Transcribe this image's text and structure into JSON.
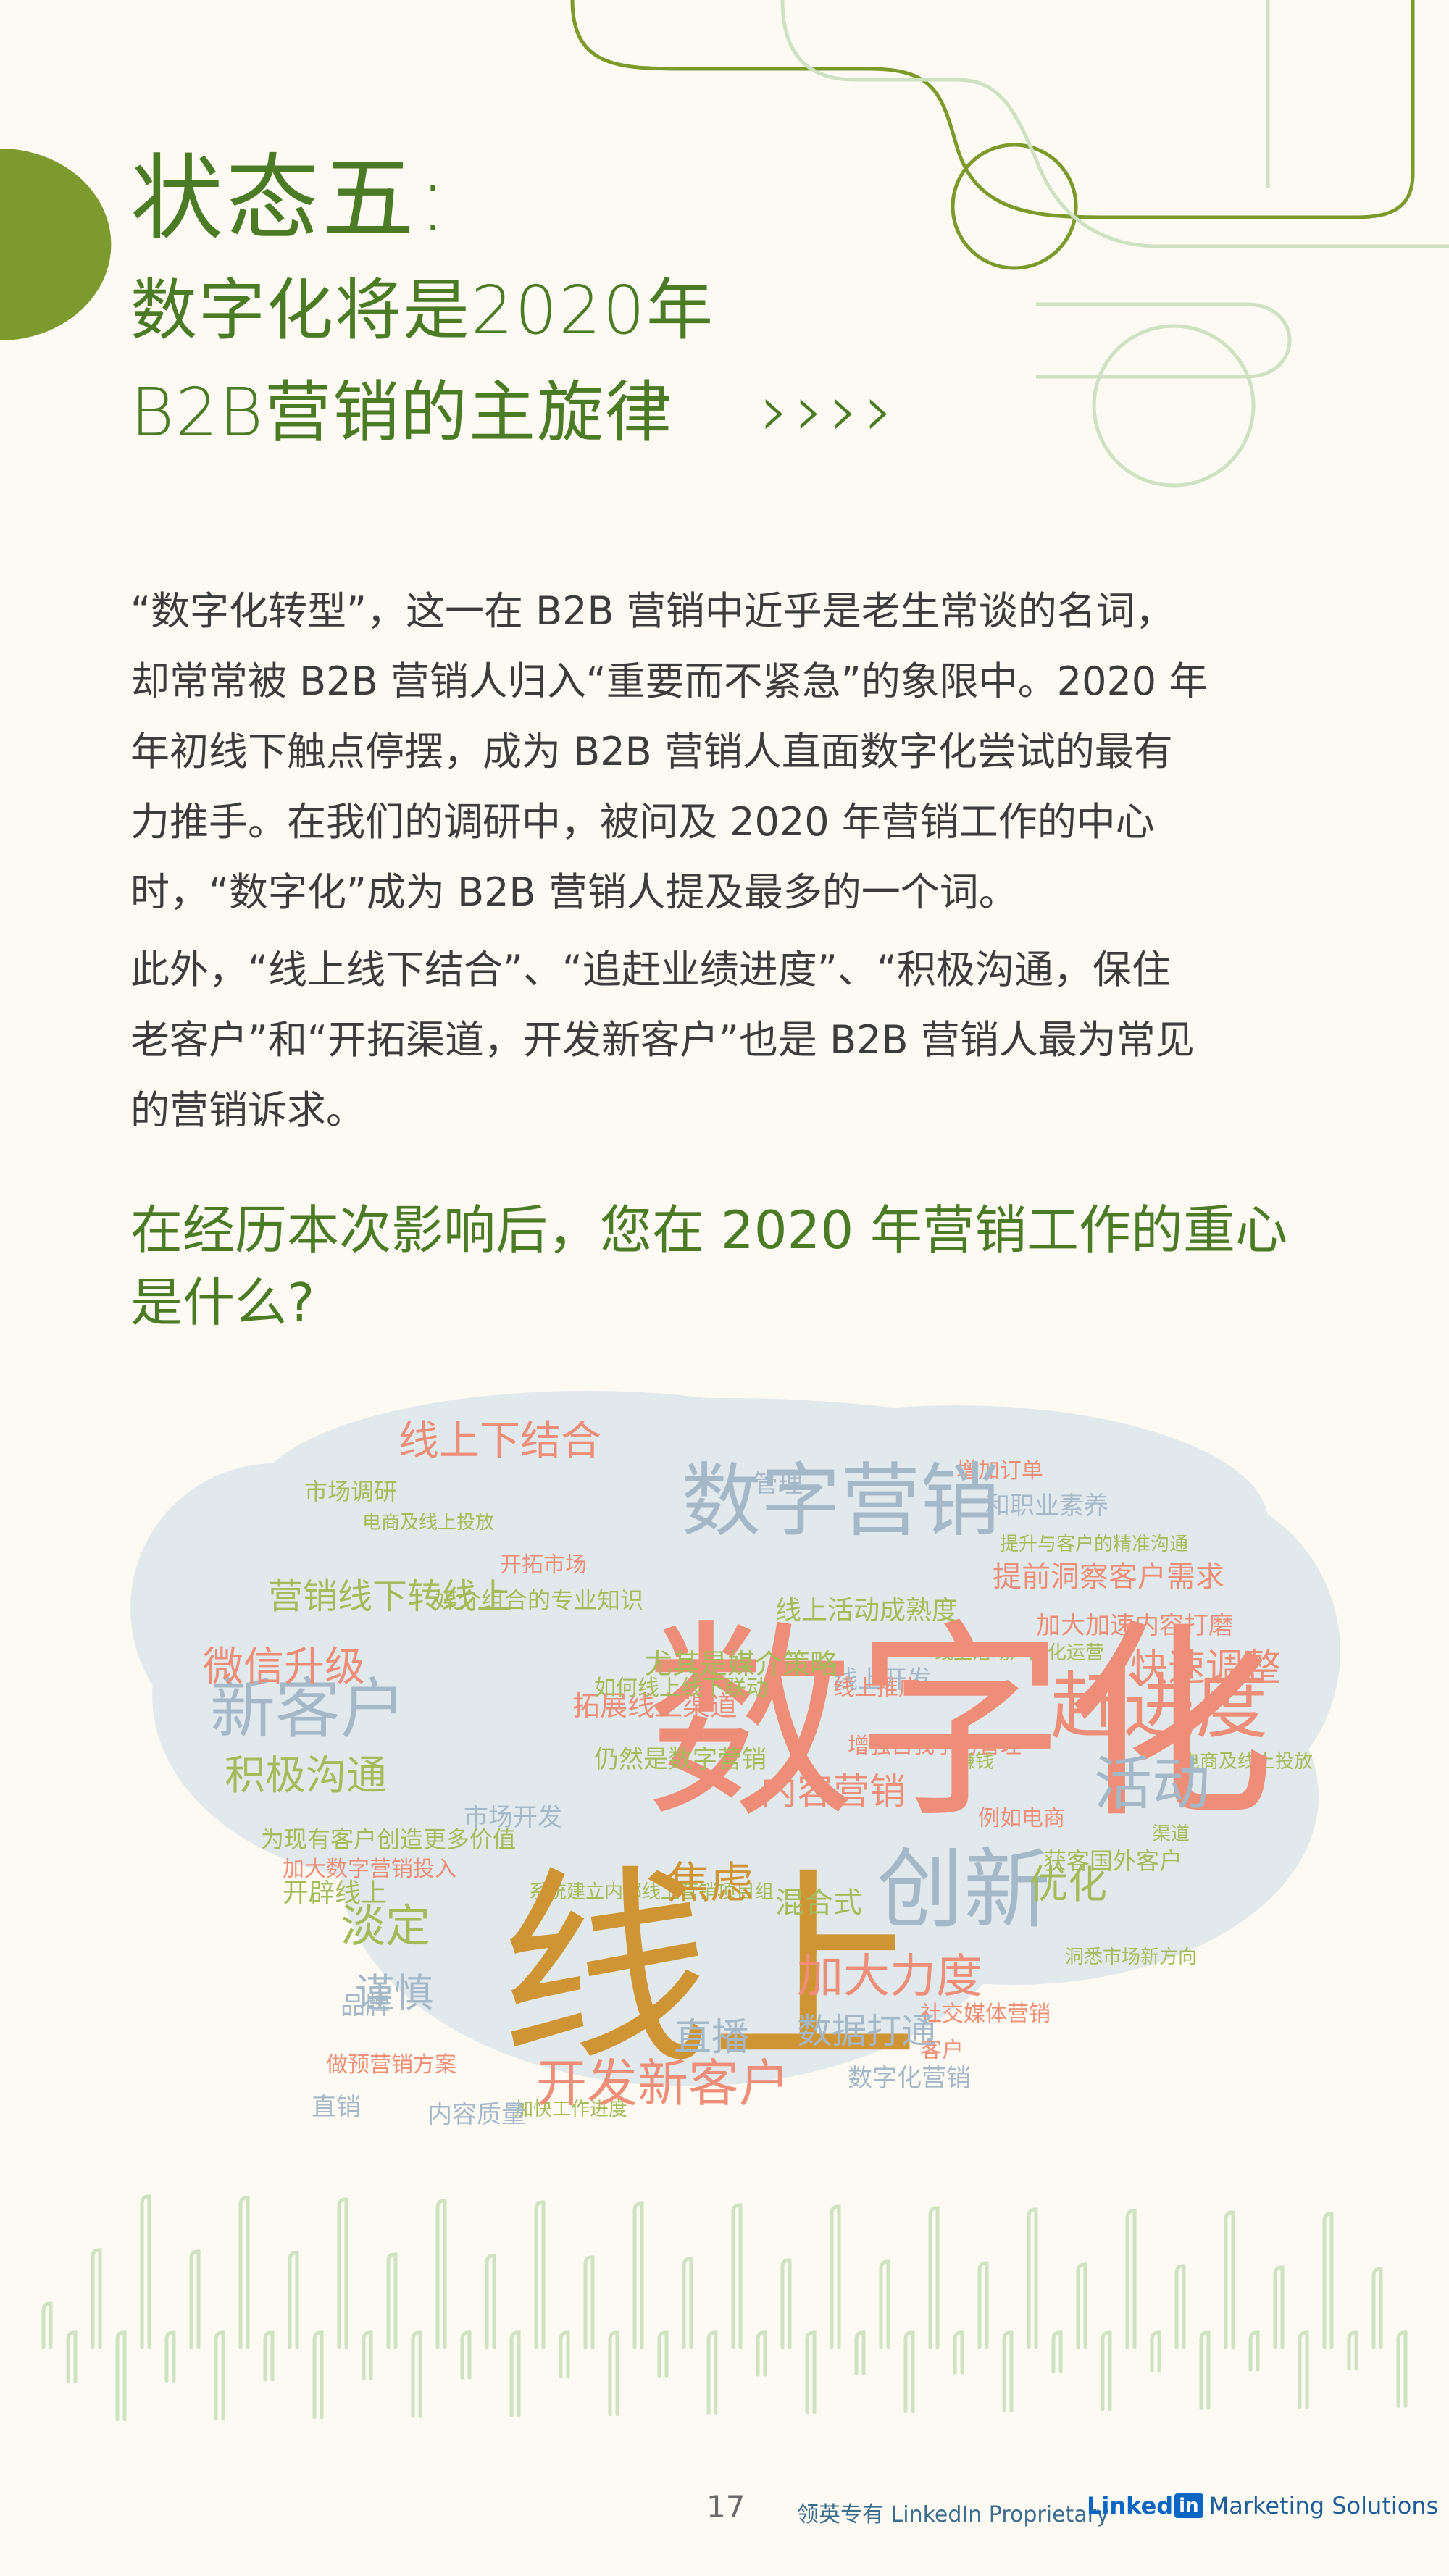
{
  "header": {
    "title": "状态五:",
    "subtitle_line1": "数字化将是2020年",
    "subtitle_line2": "B2B营销的主旋律",
    "arrows": "››››"
  },
  "body": {
    "p1": [
      "“数字化转型”，这一在 B2B 营销中近乎是老生常谈的名词，",
      "却常常被 B2B 营销人归入“重要而不紧急”的象限中。2020 年",
      "年初线下触点停摆，成为 B2B 营销人直面数字化尝试的最有",
      "力推手。在我们的调研中，被问及 2020 年营销工作的中心",
      "时，“数字化”成为 B2B 营销人提及最多的一个词。"
    ],
    "p2": [
      "此外，“线上线下结合”、“追赶业绩进度”、“积极沟通，保住",
      "老客户”和“开拓渠道，开发新客户”也是 B2B 营销人最为常见",
      "的营销诉求。"
    ]
  },
  "question": {
    "line1": "在经历本次影响后，您在 2020 年营销工作的重心",
    "line2": "是什么?"
  },
  "wordcloud": {
    "words": [
      "数字化",
      "线上",
      "数字营销",
      "创新",
      "赶进度",
      "新客户",
      "线上下结合",
      "营销线下转线上",
      "微信升级",
      "积极沟通",
      "活动",
      "快速调整",
      "开发新客户",
      "加大力度",
      "数据打通",
      "直播",
      "淡定",
      "谨慎",
      "焦虑",
      "混合式",
      "优化",
      "内容营销",
      "尤其是媒介策略",
      "仍然是数字营销",
      "线上活动成熟度",
      "提前洞察客户需求",
      "获客国外客户",
      "市场调研",
      "拓展线上渠道",
      "如何线上线下联动",
      "媒介组合的专业知识",
      "加大加速内容打磨",
      "开辟线上",
      "加大数字营销投入",
      "为现有客户创造更多价值",
      "电商及线上投放",
      "增加订单",
      "和职业素养",
      "提升与客户的精准沟通",
      "开拓市场",
      "管理",
      "线上活动产品化运营",
      "增强自我学习管理",
      "市场开发",
      "赚钱",
      "例如电商",
      "线上开发",
      "系统建立内部线上营销项目组",
      "社交媒体营销",
      "数字化营销",
      "加快工作进度",
      "做预营销方案",
      "内容质量",
      "洞悉市场新方向",
      "线上推广",
      "品牌",
      "渠道",
      "客户",
      "直销"
    ]
  },
  "footer": {
    "page_number": "17",
    "proprietary": "领英专有 LinkedIn Proprietary",
    "brand_linked": "Linked",
    "brand_in": "in",
    "brand_suffix": "Marketing Solutions"
  },
  "colors": {
    "green": "#4b7b25",
    "blob": "#e3eaee",
    "word_salmon": "#ef8e78",
    "word_gold": "#cf9434",
    "word_blue": "#a5b8c8",
    "word_green": "#a3bb5a"
  }
}
